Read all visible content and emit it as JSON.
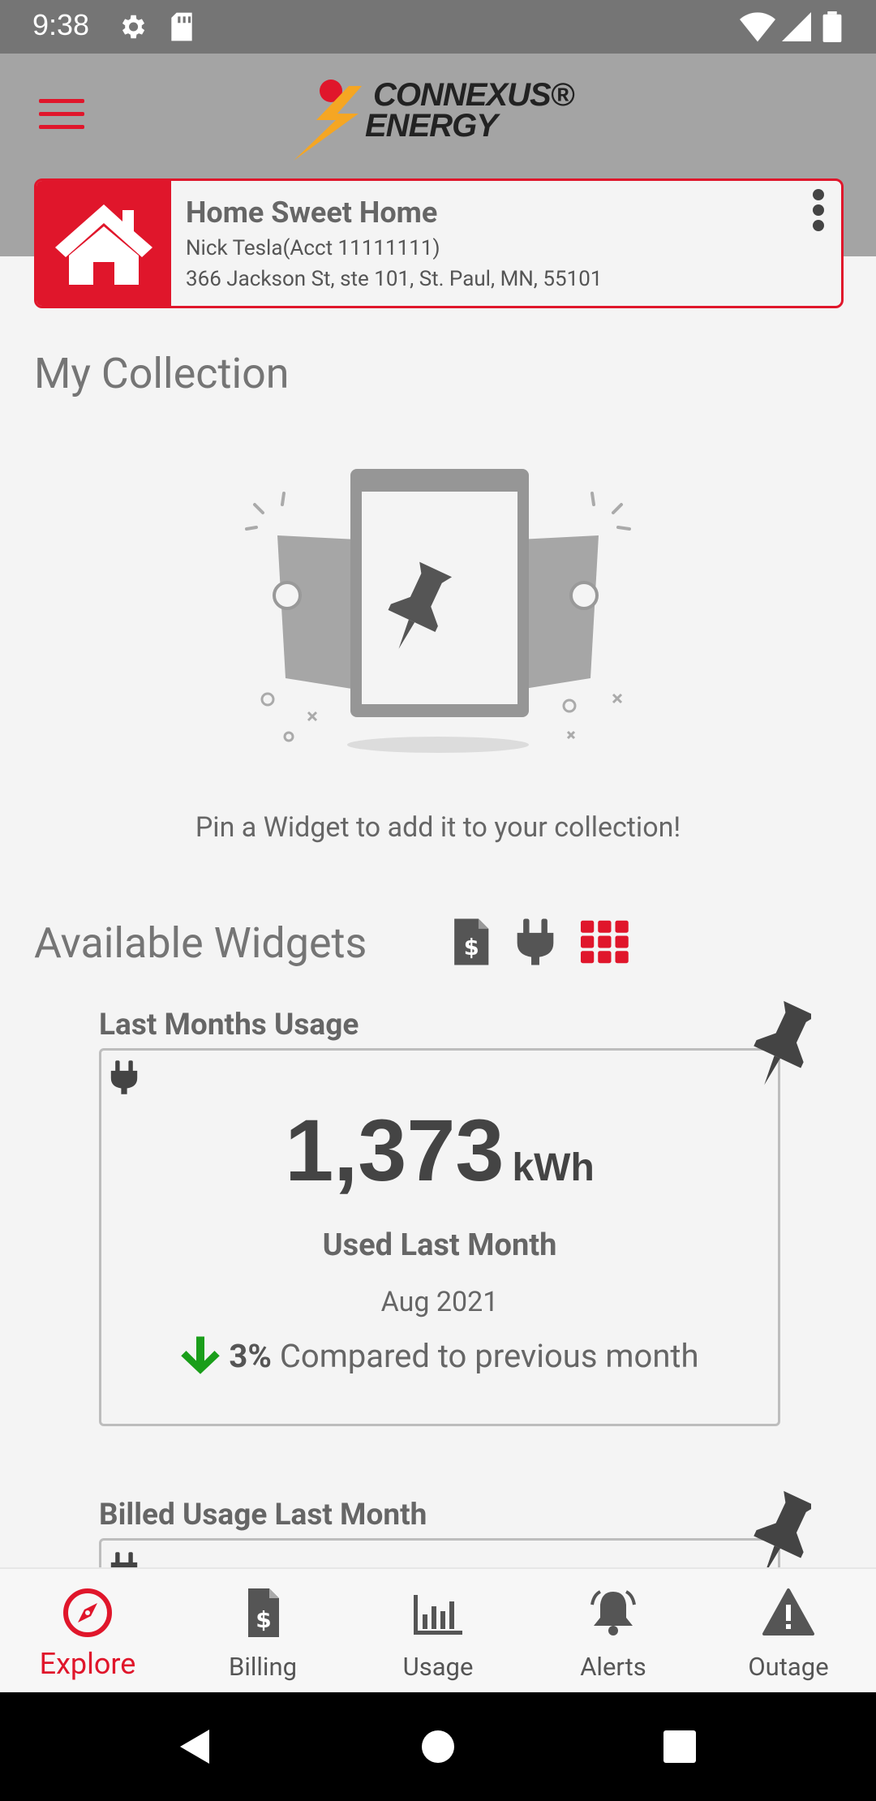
{
  "status_bar": {
    "time": "9:38"
  },
  "header": {
    "logo_line1": "CONNEXUS®",
    "logo_line2": "ENERGY"
  },
  "account": {
    "name": "Home Sweet Home",
    "holder": "Nick Tesla(Acct 11111111)",
    "address": "366 Jackson St, ste 101, St. Paul, MN, 55101"
  },
  "collection": {
    "title": "My Collection",
    "empty_message": "Pin a Widget to add it to your collection!"
  },
  "available": {
    "title": "Available Widgets",
    "filters": [
      "billing-filter-icon",
      "usage-filter-icon",
      "all-widgets-filter-icon"
    ],
    "active_filter": "all-widgets-filter-icon"
  },
  "widgets": [
    {
      "title": "Last Months Usage",
      "value": "1,373",
      "unit": "kWh",
      "label": "Used Last Month",
      "period": "Aug 2021",
      "change_pct": "3%",
      "change_text": "Compared to previous month",
      "change_direction": "down"
    },
    {
      "title": "Billed Usage Last Month"
    }
  ],
  "bottom_nav": {
    "items": [
      {
        "label": "Explore",
        "icon": "compass-icon",
        "active": true
      },
      {
        "label": "Billing",
        "icon": "bill-icon",
        "active": false
      },
      {
        "label": "Usage",
        "icon": "bar-chart-icon",
        "active": false
      },
      {
        "label": "Alerts",
        "icon": "bell-icon",
        "active": false
      },
      {
        "label": "Outage",
        "icon": "warning-icon",
        "active": false
      }
    ]
  },
  "colors": {
    "accent": "#e0162b",
    "header_bg": "#a4a4a4",
    "status_bar": "#757575",
    "positive": "#1a9e1a"
  }
}
